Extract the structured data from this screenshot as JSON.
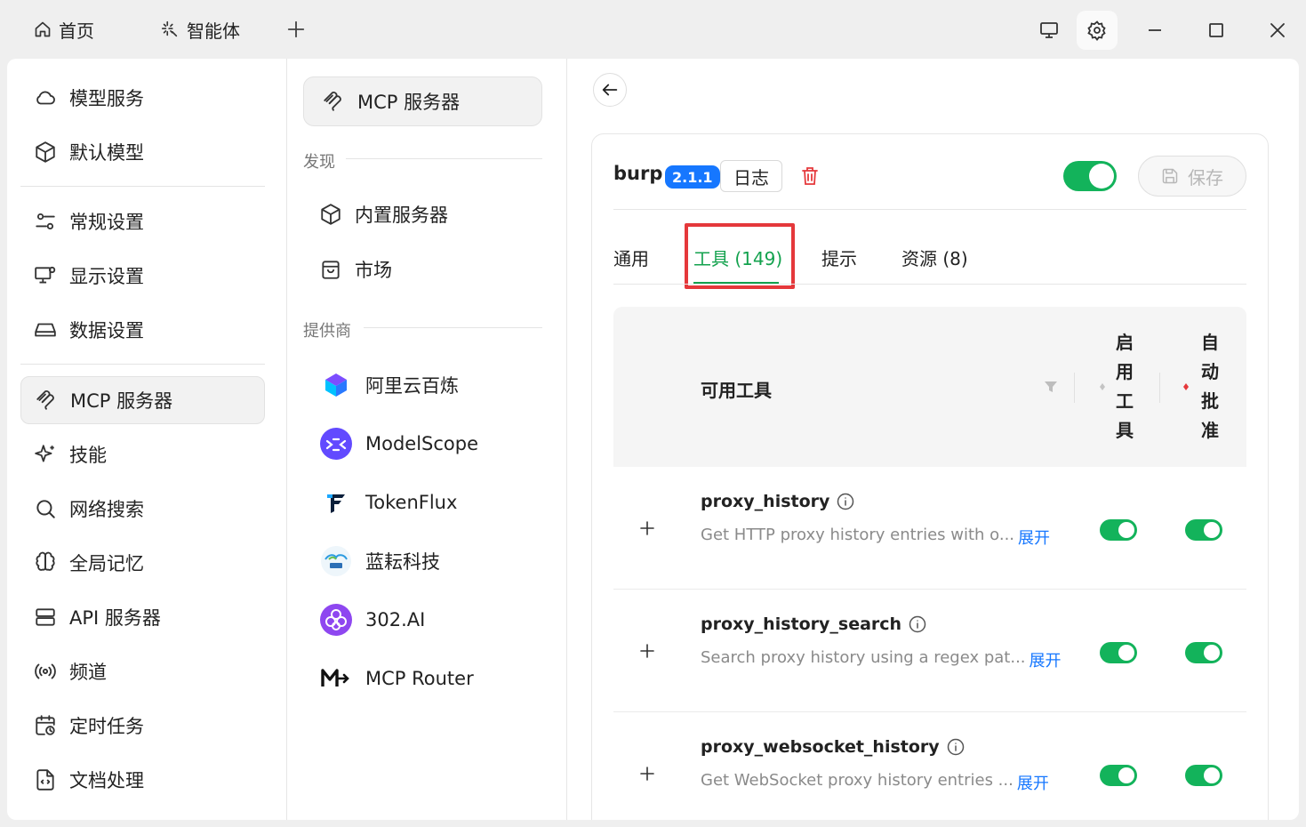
{
  "titlebar": {
    "tabs": [
      {
        "label": "首页",
        "icon": "home-icon"
      },
      {
        "label": "智能体",
        "icon": "sparkle-icon"
      }
    ],
    "add_tab_icon": "plus-icon",
    "buttons": [
      "monitor-icon",
      "gear-icon",
      "minimize-icon",
      "maximize-icon",
      "close-icon"
    ]
  },
  "nav": {
    "items": [
      {
        "label": "模型服务",
        "icon": "cloud-icon"
      },
      {
        "label": "默认模型",
        "icon": "cube-icon"
      },
      {
        "label": "常规设置",
        "icon": "sliders-icon"
      },
      {
        "label": "显示设置",
        "icon": "display-settings-icon"
      },
      {
        "label": "数据设置",
        "icon": "drive-icon"
      },
      {
        "label": "MCP 服务器",
        "icon": "mcp-icon",
        "active": true
      },
      {
        "label": "技能",
        "icon": "sparkles-icon"
      },
      {
        "label": "网络搜索",
        "icon": "search-icon"
      },
      {
        "label": "全局记忆",
        "icon": "brain-icon"
      },
      {
        "label": "API 服务器",
        "icon": "server-icon"
      },
      {
        "label": "频道",
        "icon": "broadcast-icon"
      },
      {
        "label": "定时任务",
        "icon": "calendar-clock-icon"
      },
      {
        "label": "文档处理",
        "icon": "file-code-icon"
      }
    ]
  },
  "mid": {
    "header": "MCP 服务器",
    "discover_label": "发现",
    "discover_items": [
      {
        "label": "内置服务器",
        "icon": "cube-icon"
      },
      {
        "label": "市场",
        "icon": "shopping-bag-icon"
      }
    ],
    "providers_label": "提供商",
    "providers": [
      {
        "label": "阿里云百炼",
        "icon": "bailian-logo"
      },
      {
        "label": "ModelScope",
        "icon": "modelscope-logo"
      },
      {
        "label": "TokenFlux",
        "icon": "tokenflux-logo"
      },
      {
        "label": "蓝耘科技",
        "icon": "lanyun-logo"
      },
      {
        "label": "302.AI",
        "icon": "302ai-logo"
      },
      {
        "label": "MCP Router",
        "icon": "mcprouter-logo"
      }
    ]
  },
  "server": {
    "name": "burp",
    "version": "2.1.1",
    "log_label": "日志",
    "enabled": true,
    "save_label": "保存",
    "tabs": [
      "通用",
      "工具 (149)",
      "提示",
      "资源 (8)"
    ],
    "active_tab": 1
  },
  "tools_table": {
    "headers": {
      "name": "可用工具",
      "enable": [
        "启",
        "用",
        "工",
        "具"
      ],
      "auto_approve": [
        "自",
        "动",
        "批",
        "准"
      ]
    },
    "more_label": "展开",
    "rows": [
      {
        "name": "proxy_history",
        "description": "Get HTTP proxy history entries with o...",
        "enabled": true,
        "auto_approve": true
      },
      {
        "name": "proxy_history_search",
        "description": "Search proxy history using a regex pat...",
        "enabled": true,
        "auto_approve": true
      },
      {
        "name": "proxy_websocket_history",
        "description": "Get WebSocket proxy history entries ...",
        "enabled": true,
        "auto_approve": true
      }
    ]
  },
  "colors": {
    "accent_green": "#13a24e",
    "toggle_green": "#13b35b",
    "badge_blue": "#1677ff",
    "highlight_red": "#e5383b"
  }
}
